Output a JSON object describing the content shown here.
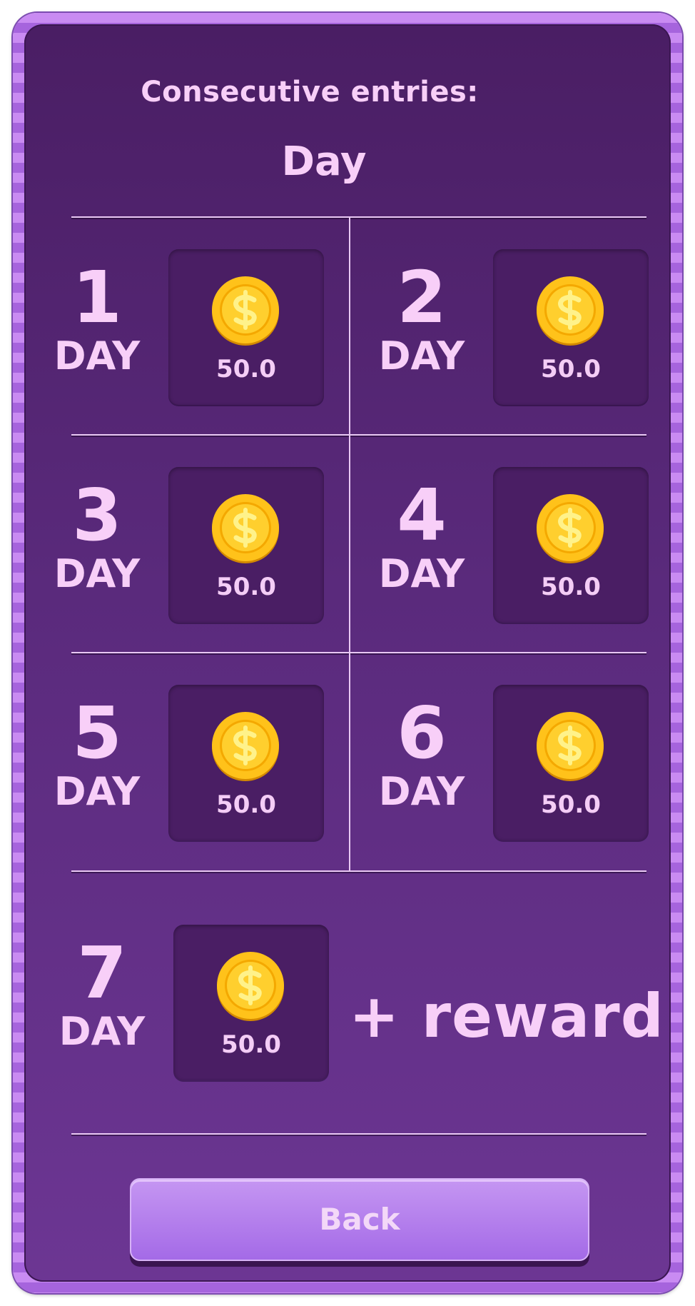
{
  "dialog": {
    "title": "Consecutive entries:",
    "subtitle": "Day"
  },
  "rewards": [
    {
      "day": "1",
      "day_label": "DAY",
      "amount": "50.0",
      "icon": "coin-icon"
    },
    {
      "day": "2",
      "day_label": "DAY",
      "amount": "50.0",
      "icon": "coin-icon"
    },
    {
      "day": "3",
      "day_label": "DAY",
      "amount": "50.0",
      "icon": "coin-icon"
    },
    {
      "day": "4",
      "day_label": "DAY",
      "amount": "50.0",
      "icon": "coin-icon"
    },
    {
      "day": "5",
      "day_label": "DAY",
      "amount": "50.0",
      "icon": "coin-icon"
    },
    {
      "day": "6",
      "day_label": "DAY",
      "amount": "50.0",
      "icon": "coin-icon"
    },
    {
      "day": "7",
      "day_label": "DAY",
      "amount": "50.0",
      "icon": "coin-icon",
      "bonus": "+ reward"
    }
  ],
  "buttons": {
    "back_label": "Back"
  },
  "colors": {
    "panel": "#5a2a7c",
    "reward_box": "#4a1e64",
    "text": "#f8cff8",
    "coin": "#f5b800",
    "button": "#b07cea"
  }
}
